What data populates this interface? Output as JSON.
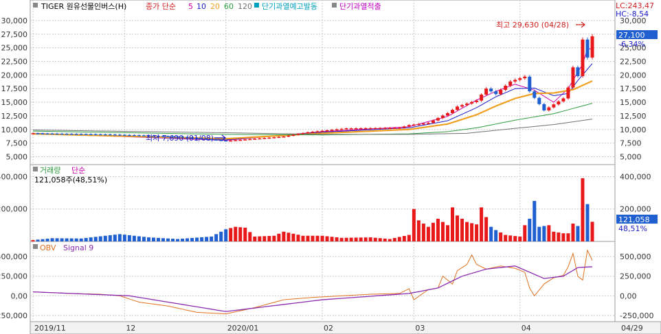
{
  "legend": {
    "name": "TIGER 원유선물인버스(H)",
    "price_label": "종가 단순",
    "ma_periods": [
      "5",
      "10",
      "20",
      "60",
      "120"
    ],
    "signal1": "단기과열예고발동",
    "signal2": "단기과열적출"
  },
  "right_info": {
    "lc": "LC:243,47",
    "hc": "HC:-8,54"
  },
  "price": {
    "ticks": [
      "30,000",
      "27,500",
      "25,000",
      "22,500",
      "20,000",
      "17,500",
      "15,000",
      "12,500",
      "10,000",
      "7,500",
      "5,000"
    ],
    "tick_values": [
      30000,
      27500,
      25000,
      22500,
      20000,
      17500,
      15000,
      12500,
      10000,
      7500,
      5000
    ],
    "ylim": [
      3800,
      31500
    ],
    "last": "27,100",
    "change": "-6,34%",
    "max_label": "최고 29,630 (04/28)",
    "min_label": "최저 7,690 (01/08)"
  },
  "volume": {
    "title": "거래량",
    "mode": "단순",
    "current": "121,058주(48,51%)",
    "ticks": [
      "400,000",
      "200,000"
    ],
    "tick_values": [
      400000,
      200000
    ],
    "ylim": [
      0,
      440000
    ],
    "last": "121,058",
    "pct": "48,51%"
  },
  "obv": {
    "title": "OBV",
    "signal": "Signal 9",
    "ticks": [
      "500,000",
      "250,000",
      "0,00",
      "-250,000"
    ],
    "tick_values": [
      500000,
      250000,
      0,
      -250000
    ],
    "ylim": [
      -320000,
      640000
    ]
  },
  "dates": [
    {
      "label": "2019/11",
      "index": 0
    },
    {
      "label": "12",
      "index": 19
    },
    {
      "label": "2020/01",
      "index": 40
    },
    {
      "label": "02",
      "index": 60
    },
    {
      "label": "03",
      "index": 79
    },
    {
      "label": "04",
      "index": 101
    },
    {
      "label": "04/29",
      "index": 116
    }
  ],
  "colors": {
    "up": "#e8191b",
    "down": "#1f5fd0",
    "ma5": "#cc00aa",
    "ma10": "#1a1ac8",
    "ma20": "#f0a020",
    "ma60": "#2c9a3c",
    "ma120": "#707070",
    "obv": "#e07020",
    "signal": "#8a2ab0",
    "signal1": "#00a0c0",
    "signal2": "#c000c0"
  },
  "chart_data": {
    "type": "candlestick",
    "n": 117,
    "price_keys": [
      [
        0,
        9300
      ],
      [
        15,
        9100
      ],
      [
        30,
        8700
      ],
      [
        40,
        7900
      ],
      [
        52,
        8700
      ],
      [
        57,
        9500
      ],
      [
        65,
        10200
      ],
      [
        76,
        10300
      ],
      [
        78,
        10800
      ],
      [
        82,
        11200
      ],
      [
        86,
        13000
      ],
      [
        88,
        14200
      ],
      [
        92,
        15300
      ],
      [
        94,
        17500
      ],
      [
        96,
        16500
      ],
      [
        99,
        18800
      ],
      [
        102,
        19700
      ],
      [
        103,
        17000
      ],
      [
        104,
        15800
      ],
      [
        106,
        13500
      ],
      [
        108,
        14600
      ],
      [
        110,
        15700
      ],
      [
        111,
        17700
      ],
      [
        112,
        21400
      ],
      [
        113,
        19800
      ],
      [
        114,
        26500
      ],
      [
        115,
        23200
      ],
      [
        116,
        27100
      ]
    ],
    "volume_keys": [
      [
        0,
        8000
      ],
      [
        4,
        20000
      ],
      [
        10,
        18000
      ],
      [
        18,
        45000
      ],
      [
        24,
        25000
      ],
      [
        30,
        15000
      ],
      [
        37,
        30000
      ],
      [
        40,
        75000
      ],
      [
        42,
        90000
      ],
      [
        44,
        85000
      ],
      [
        46,
        30000
      ],
      [
        50,
        35000
      ],
      [
        52,
        60000
      ],
      [
        56,
        35000
      ],
      [
        60,
        35000
      ],
      [
        64,
        22000
      ],
      [
        70,
        25000
      ],
      [
        74,
        15000
      ],
      [
        78,
        40000
      ],
      [
        79,
        200000
      ],
      [
        80,
        130000
      ],
      [
        82,
        90000
      ],
      [
        84,
        140000
      ],
      [
        86,
        100000
      ],
      [
        87,
        210000
      ],
      [
        88,
        160000
      ],
      [
        90,
        120000
      ],
      [
        92,
        105000
      ],
      [
        93,
        210000
      ],
      [
        95,
        90000
      ],
      [
        96,
        70000
      ],
      [
        98,
        40000
      ],
      [
        101,
        30000
      ],
      [
        102,
        100000
      ],
      [
        103,
        140000
      ],
      [
        104,
        250000
      ],
      [
        105,
        90000
      ],
      [
        107,
        100000
      ],
      [
        108,
        60000
      ],
      [
        110,
        50000
      ],
      [
        111,
        50000
      ],
      [
        112,
        110000
      ],
      [
        113,
        95000
      ],
      [
        114,
        390000
      ],
      [
        115,
        230000
      ],
      [
        116,
        121058
      ]
    ],
    "obv_keys": [
      [
        0,
        50000
      ],
      [
        8,
        30000
      ],
      [
        14,
        20000
      ],
      [
        18,
        0
      ],
      [
        22,
        -80000
      ],
      [
        28,
        -130000
      ],
      [
        34,
        -210000
      ],
      [
        40,
        -230000
      ],
      [
        46,
        -150000
      ],
      [
        52,
        -50000
      ],
      [
        58,
        -20000
      ],
      [
        64,
        0
      ],
      [
        70,
        20000
      ],
      [
        76,
        30000
      ],
      [
        78,
        90000
      ],
      [
        79,
        -50000
      ],
      [
        82,
        80000
      ],
      [
        84,
        100000
      ],
      [
        85,
        250000
      ],
      [
        87,
        150000
      ],
      [
        88,
        320000
      ],
      [
        90,
        400000
      ],
      [
        91,
        520000
      ],
      [
        92,
        400000
      ],
      [
        94,
        340000
      ],
      [
        97,
        380000
      ],
      [
        100,
        350000
      ],
      [
        102,
        300000
      ],
      [
        103,
        100000
      ],
      [
        104,
        0
      ],
      [
        106,
        150000
      ],
      [
        108,
        230000
      ],
      [
        110,
        260000
      ],
      [
        111,
        370000
      ],
      [
        112,
        540000
      ],
      [
        113,
        250000
      ],
      [
        114,
        200000
      ],
      [
        115,
        580000
      ],
      [
        116,
        450000
      ]
    ],
    "signal_keys": [
      [
        0,
        50000
      ],
      [
        20,
        0
      ],
      [
        40,
        -200000
      ],
      [
        60,
        -50000
      ],
      [
        78,
        30000
      ],
      [
        84,
        100000
      ],
      [
        89,
        250000
      ],
      [
        94,
        340000
      ],
      [
        100,
        380000
      ],
      [
        103,
        300000
      ],
      [
        106,
        220000
      ],
      [
        110,
        250000
      ],
      [
        113,
        360000
      ],
      [
        116,
        370000
      ]
    ],
    "ma_keys": {
      "ma5": [
        [
          0,
          9300
        ],
        [
          40,
          8000
        ],
        [
          60,
          9600
        ],
        [
          78,
          10500
        ],
        [
          86,
          12400
        ],
        [
          92,
          15400
        ],
        [
          96,
          17000
        ],
        [
          100,
          18300
        ],
        [
          104,
          17200
        ],
        [
          108,
          15000
        ],
        [
          111,
          17500
        ],
        [
          113,
          20500
        ],
        [
          114,
          22000
        ],
        [
          115,
          24800
        ],
        [
          116,
          24800
        ]
      ],
      "ma10": [
        [
          0,
          9300
        ],
        [
          40,
          8100
        ],
        [
          60,
          9500
        ],
        [
          78,
          10300
        ],
        [
          86,
          11600
        ],
        [
          92,
          14000
        ],
        [
          96,
          16000
        ],
        [
          100,
          17500
        ],
        [
          104,
          17600
        ],
        [
          108,
          16200
        ],
        [
          111,
          16600
        ],
        [
          113,
          19000
        ],
        [
          116,
          22100
        ]
      ],
      "ma20": [
        [
          0,
          9200
        ],
        [
          40,
          8300
        ],
        [
          60,
          9300
        ],
        [
          78,
          10000
        ],
        [
          86,
          11000
        ],
        [
          92,
          12700
        ],
        [
          96,
          14300
        ],
        [
          100,
          15700
        ],
        [
          104,
          16600
        ],
        [
          108,
          16700
        ],
        [
          112,
          17300
        ],
        [
          116,
          18900
        ]
      ],
      "ma60": [
        [
          0,
          9700
        ],
        [
          40,
          9100
        ],
        [
          60,
          9000
        ],
        [
          78,
          9200
        ],
        [
          86,
          9600
        ],
        [
          92,
          10300
        ],
        [
          100,
          11700
        ],
        [
          108,
          12900
        ],
        [
          116,
          14800
        ]
      ],
      "ma120": [
        [
          0,
          9900
        ],
        [
          40,
          9400
        ],
        [
          60,
          9100
        ],
        [
          78,
          9100
        ],
        [
          90,
          9300
        ],
        [
          100,
          10200
        ],
        [
          108,
          10900
        ],
        [
          116,
          11900
        ]
      ]
    }
  }
}
